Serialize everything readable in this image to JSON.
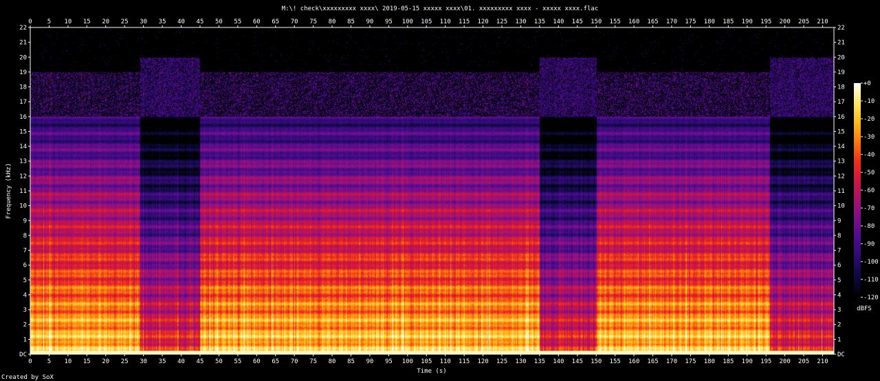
{
  "chart_data": {
    "type": "heatmap",
    "title": "M:\\! check\\xxxxxxxxx xxxx\\ 2019-05-15  xxxxx xxxx\\01. xxxxxxxxx xxxx - xxxxx xxxx.flac",
    "xlabel": "Time (s)",
    "ylabel": "Frequency (kHz)",
    "x_range": [
      0,
      213
    ],
    "y_range": [
      0,
      22
    ],
    "x_ticks": [
      0,
      5,
      10,
      15,
      20,
      25,
      30,
      35,
      40,
      45,
      50,
      55,
      60,
      65,
      70,
      75,
      80,
      85,
      90,
      95,
      100,
      105,
      110,
      115,
      120,
      125,
      130,
      135,
      140,
      145,
      150,
      155,
      160,
      165,
      170,
      175,
      180,
      185,
      190,
      195,
      200,
      205,
      210
    ],
    "y_ticks": [
      "DC",
      "1",
      "2",
      "3",
      "4",
      "5",
      "6",
      "7",
      "8",
      "9",
      "10",
      "11",
      "12",
      "13",
      "14",
      "15",
      "16",
      "17",
      "18",
      "19",
      "20",
      "21",
      "22"
    ],
    "colorbar": {
      "label": "dBFS",
      "ticks": [
        "+0",
        "-10",
        "-20",
        "-30",
        "-40",
        "-50",
        "-60",
        "-70",
        "-80",
        "-90",
        "-100",
        "-110",
        "-120"
      ],
      "range": [
        -120,
        0
      ],
      "colors": [
        "#000000",
        "#0b0a3a",
        "#2a0a6e",
        "#4b0c8c",
        "#7a0f8a",
        "#a8126e",
        "#d0163e",
        "#f0301a",
        "#fb7a10",
        "#fdbc1c",
        "#fde86a",
        "#ffffff"
      ]
    },
    "cutoff_khz": 16,
    "quiet_sections_s": [
      [
        29,
        45
      ],
      [
        135,
        150
      ],
      [
        196,
        213
      ]
    ],
    "footer": "Created by SoX"
  }
}
